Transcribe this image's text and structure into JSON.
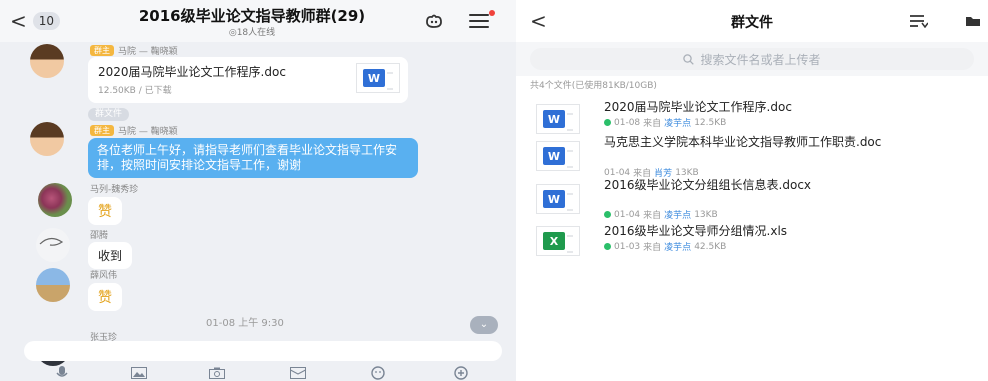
{
  "chat": {
    "back_symbol": "<",
    "unread_count": "10",
    "title": "2016级毕业论文指导教师群(29)",
    "subtitle": "◎18人在线",
    "messages": [
      {
        "sender_tag": "群主",
        "sender": "马院 — 鞠晓颖",
        "file_name": "2020届马院毕业论文工作程序.doc",
        "file_meta": "12.50KB / 已下载",
        "file_icon": "W"
      },
      {
        "pill": "群文件"
      },
      {
        "sender_tag": "群主",
        "sender": "马院 — 鞠晓颖",
        "text": "各位老师上午好，请指导老师们查看毕业论文指导工作安排，按照时间安排论文指导工作，谢谢"
      },
      {
        "sender": "马列-魏秀珍",
        "emoji": "赞"
      },
      {
        "sender": "邵腾",
        "text": "收到"
      },
      {
        "sender": "薛风伟",
        "emoji": "赞"
      },
      {
        "time": "01-08 上午 9:30"
      },
      {
        "sender": "张玉珍"
      }
    ],
    "toolbar_icons": [
      "mic-icon",
      "image-icon",
      "camera-icon",
      "red-packet-icon",
      "emoji-icon",
      "plus-icon"
    ]
  },
  "files": {
    "back_symbol": "<",
    "title": "群文件",
    "search_placeholder": "搜索文件名或者上传者",
    "count_text": "共4个文件(已使用81KB/10GB)",
    "items": [
      {
        "name": "2020届马院毕业论文工作程序.doc",
        "date": "01-08",
        "from": "来自",
        "uploader": "凌芋点",
        "size": "12.5KB",
        "type": "W",
        "downloaded": true
      },
      {
        "name": "马克思主义学院本科毕业论文指导教师工作职责.doc",
        "date": "01-04",
        "from": "来自",
        "uploader": "肖芳",
        "size": "13KB",
        "type": "W",
        "downloaded": false
      },
      {
        "name": "2016级毕业论文分组组长信息表.docx",
        "date": "01-04",
        "from": "来自",
        "uploader": "凌芋点",
        "size": "13KB",
        "type": "W",
        "downloaded": true
      },
      {
        "name": "2016级毕业论文导师分组情况.xls",
        "date": "01-03",
        "from": "来自",
        "uploader": "凌芋点",
        "size": "42.5KB",
        "type": "X",
        "downloaded": true
      }
    ]
  },
  "colors": {
    "accent_blue": "#59b0f0",
    "word_blue": "#2f6fd6",
    "excel_green": "#1f9a4d",
    "status_green": "#2bbf6a",
    "owner_tag": "#f4b740"
  }
}
